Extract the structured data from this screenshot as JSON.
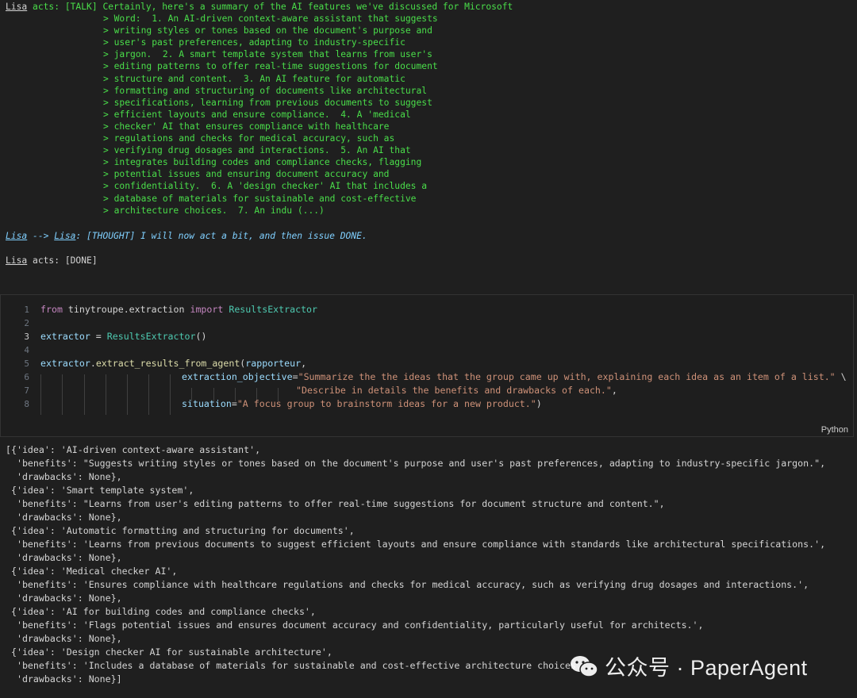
{
  "talk": {
    "name": "Lisa",
    "prefix": " acts: [TALK] ",
    "first_line": "Certainly, here's a summary of the AI features we've discussed for Microsoft",
    "lines": [
      "> Word:  1. An AI-driven context-aware assistant that suggests",
      "> writing styles or tones based on the document's purpose and",
      "> user's past preferences, adapting to industry-specific",
      "> jargon.  2. A smart template system that learns from user's",
      "> editing patterns to offer real-time suggestions for document",
      "> structure and content.  3. An AI feature for automatic",
      "> formatting and structuring of documents like architectural",
      "> specifications, learning from previous documents to suggest",
      "> efficient layouts and ensure compliance.  4. A 'medical",
      "> checker' AI that ensures compliance with healthcare",
      "> regulations and checks for medical accuracy, such as",
      "> verifying drug dosages and interactions.  5. An AI that",
      "> integrates building codes and compliance checks, flagging",
      "> potential issues and ensuring document accuracy and",
      "> confidentiality.  6. A 'design checker' AI that includes a",
      "> database of materials for sustainable and cost-effective",
      "> architecture choices.  7. An indu (...)"
    ]
  },
  "thought": {
    "from": "Lisa",
    "arrow": " --> ",
    "to": "Lisa",
    "text": ": [THOUGHT] I will now act a bit, and then issue DONE."
  },
  "done": {
    "name": "Lisa",
    "text": " acts: [DONE]"
  },
  "code_cell": {
    "line_numbers": [
      "1",
      "2",
      "3",
      "4",
      "5",
      "6",
      "7",
      "8"
    ],
    "language": "Python",
    "l1": {
      "kw_from": "from",
      "module": " tinytroupe.extraction ",
      "kw_import": "import",
      "cls": " ResultsExtractor"
    },
    "l3": {
      "var": "extractor",
      "eq": " = ",
      "cls": "ResultsExtractor",
      "paren": "()"
    },
    "l5": {
      "var": "extractor",
      "dot": ".",
      "fn": "extract_results_from_agent",
      "open": "(",
      "arg": "rapporteur",
      "comma": ","
    },
    "l6": {
      "param": "extraction_objective",
      "eq": "=",
      "str": "\"Summarize the the ideas that the group came up with, explaining each idea as an item of a list.\"",
      "tail": " \\"
    },
    "l7": {
      "str": "\"Describe in details the benefits and drawbacks of each.\"",
      "tail": ","
    },
    "l8": {
      "param": "situation",
      "eq": "=",
      "str": "\"A focus group to brainstorm ideas for a new product.\"",
      "tail": ")"
    }
  },
  "output_lines": [
    "[{'idea': 'AI-driven context-aware assistant',",
    "  'benefits': \"Suggests writing styles or tones based on the document's purpose and user's past preferences, adapting to industry-specific jargon.\",",
    "  'drawbacks': None},",
    " {'idea': 'Smart template system',",
    "  'benefits': \"Learns from user's editing patterns to offer real-time suggestions for document structure and content.\",",
    "  'drawbacks': None},",
    " {'idea': 'Automatic formatting and structuring for documents',",
    "  'benefits': 'Learns from previous documents to suggest efficient layouts and ensure compliance with standards like architectural specifications.',",
    "  'drawbacks': None},",
    " {'idea': 'Medical checker AI',",
    "  'benefits': 'Ensures compliance with healthcare regulations and checks for medical accuracy, such as verifying drug dosages and interactions.',",
    "  'drawbacks': None},",
    " {'idea': 'AI for building codes and compliance checks',",
    "  'benefits': 'Flags potential issues and ensures document accuracy and confidentiality, particularly useful for architects.',",
    "  'drawbacks': None},",
    " {'idea': 'Design checker AI for sustainable architecture',",
    "  'benefits': 'Includes a database of materials for sustainable and cost-effective architecture choices.',",
    "  'drawbacks': None}]"
  ],
  "watermark": {
    "text": "公众号 · PaperAgent",
    "icon": "wechat-icon"
  }
}
